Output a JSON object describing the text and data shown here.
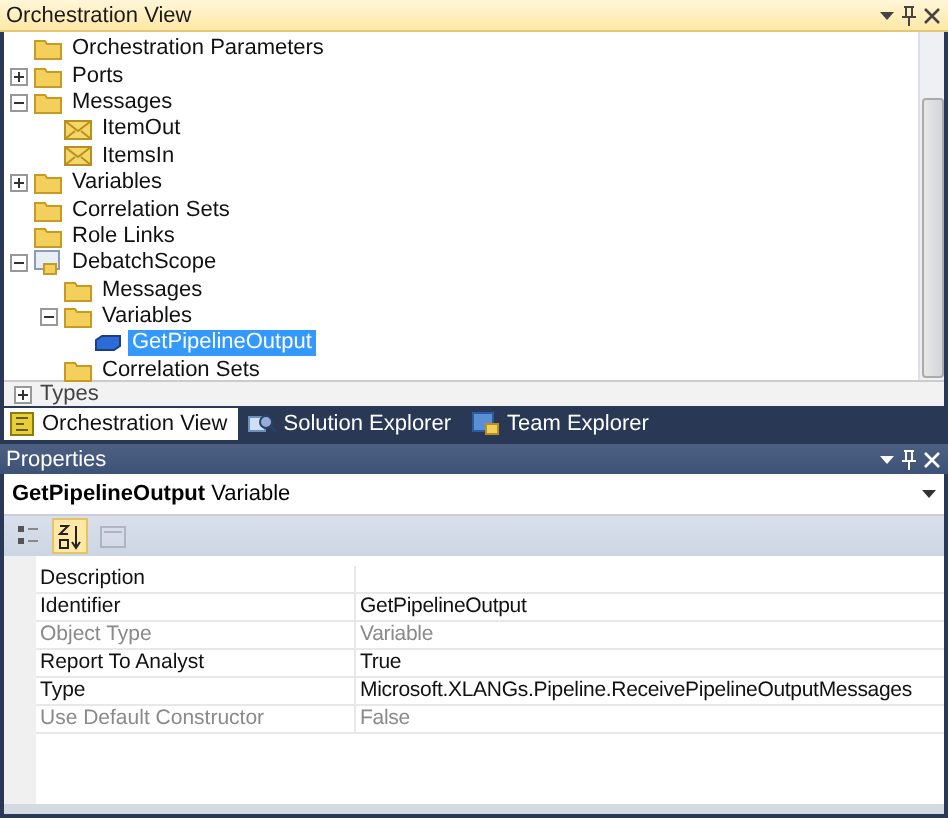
{
  "orchestration_view": {
    "title": "Orchestration View",
    "tree": [
      {
        "label": "Orchestration Parameters",
        "kind": "folder",
        "selected": false
      },
      {
        "label": "Ports",
        "kind": "folder",
        "selected": false,
        "expanded": false
      },
      {
        "label": "Messages",
        "kind": "folder",
        "selected": false,
        "expanded": true,
        "children": [
          {
            "label": "ItemOut",
            "kind": "message",
            "selected": false
          },
          {
            "label": "ItemsIn",
            "kind": "message",
            "selected": false
          }
        ]
      },
      {
        "label": "Variables",
        "kind": "folder",
        "selected": false,
        "expanded": false
      },
      {
        "label": "Correlation Sets",
        "kind": "folder",
        "selected": false
      },
      {
        "label": "Role Links",
        "kind": "folder",
        "selected": false
      },
      {
        "label": "DebatchScope",
        "kind": "scope",
        "selected": false,
        "expanded": true,
        "children": [
          {
            "label": "Messages",
            "kind": "folder",
            "selected": false
          },
          {
            "label": "Variables",
            "kind": "folder",
            "selected": false,
            "expanded": true,
            "children": [
              {
                "label": "GetPipelineOutput",
                "kind": "variable",
                "selected": true
              }
            ]
          },
          {
            "label": "Correlation Sets",
            "kind": "folder",
            "selected": false
          }
        ]
      }
    ],
    "types": {
      "label": "Types",
      "expanded": false
    }
  },
  "tabs": [
    {
      "label": "Orchestration View",
      "kind": "orchestration",
      "selected": true
    },
    {
      "label": "Solution Explorer",
      "kind": "solution",
      "selected": false
    },
    {
      "label": "Team Explorer",
      "kind": "team",
      "selected": false
    }
  ],
  "properties": {
    "title": "Properties",
    "object_name": "GetPipelineOutput",
    "object_type": "Variable",
    "toolbar": [
      {
        "kind": "categorized",
        "selected": false,
        "disabled": false
      },
      {
        "kind": "alphabetical",
        "selected": true,
        "disabled": false
      },
      {
        "kind": "pages",
        "selected": false,
        "disabled": true
      }
    ],
    "rows": [
      {
        "name": "Description",
        "disabled": false
      },
      {
        "name": "Identifier",
        "value": "GetPipelineOutput",
        "disabled": false
      },
      {
        "name": "Object Type",
        "value": "Variable",
        "disabled": true
      },
      {
        "name": "Report To Analyst",
        "value": "True",
        "disabled": false
      },
      {
        "name": "Type",
        "value": "Microsoft.XLANGs.Pipeline.ReceivePipelineOutputMessages",
        "disabled": false
      },
      {
        "name": "Use Default Constructor",
        "value": "False",
        "disabled": true
      }
    ]
  }
}
